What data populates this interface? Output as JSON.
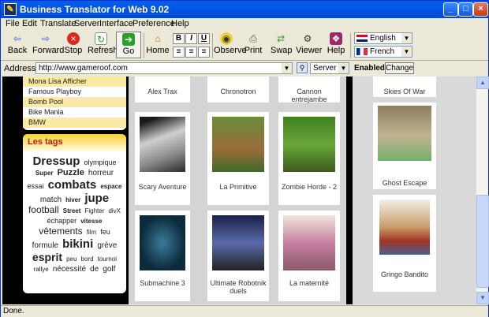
{
  "window": {
    "title": "Business Translator for Web 9.02",
    "minimize": "_",
    "maximize": "□",
    "close": "×"
  },
  "menu": [
    "File",
    "Edit",
    "Translate",
    "Server",
    "Interface",
    "Preference",
    "Help"
  ],
  "toolbar": {
    "back": "Back",
    "forward": "Forward",
    "stop": "Stop",
    "refresh": "Refresh",
    "go": "Go",
    "home": "Home",
    "bold": "B",
    "italic": "I",
    "underline": "U",
    "observe": "Observe",
    "print": "Print",
    "swap": "Swap",
    "viewer": "Viewer",
    "help": "Help"
  },
  "languages": {
    "source": "English",
    "target": "French"
  },
  "address": {
    "label": "Address",
    "url": "http://www.gameroof.com",
    "server": "Server 5",
    "status": "Enabled",
    "change": "Change"
  },
  "links": [
    {
      "label": "Mona Lisa Afficher",
      "highlight": true
    },
    {
      "label": "Famous Playboy",
      "highlight": false
    },
    {
      "label": "Bomb Pool",
      "highlight": true
    },
    {
      "label": "Bike Mania",
      "highlight": false
    },
    {
      "label": "BMW",
      "highlight": true
    }
  ],
  "tags_title": "Les tags",
  "tags": [
    {
      "t": "Dressup",
      "s": 15,
      "b": true
    },
    {
      "t": "olympique",
      "s": 9
    },
    {
      "t": "Super",
      "s": 8,
      "b": true
    },
    {
      "t": "Puzzle",
      "s": 11,
      "b": true
    },
    {
      "t": "horreur",
      "s": 10
    },
    {
      "t": "essai",
      "s": 9
    },
    {
      "t": "combats",
      "s": 15,
      "b": true
    },
    {
      "t": "espace",
      "s": 8,
      "b": true
    },
    {
      "t": "match",
      "s": 10
    },
    {
      "t": "hiver",
      "s": 8,
      "b": true
    },
    {
      "t": "jupe",
      "s": 15,
      "b": true
    },
    {
      "t": "football",
      "s": 12
    },
    {
      "t": "Street",
      "s": 8,
      "b": true
    },
    {
      "t": "Fighter",
      "s": 8
    },
    {
      "t": "divX",
      "s": 8
    },
    {
      "t": "échapper",
      "s": 9
    },
    {
      "t": "vitesse",
      "s": 8,
      "b": true
    },
    {
      "t": "vêtements",
      "s": 12
    },
    {
      "t": "film",
      "s": 8
    },
    {
      "t": "feu",
      "s": 9
    },
    {
      "t": "formule",
      "s": 10
    },
    {
      "t": "bikini",
      "s": 15,
      "b": true
    },
    {
      "t": "grève",
      "s": 10
    },
    {
      "t": "esprit",
      "s": 14,
      "b": true
    },
    {
      "t": "peu",
      "s": 8
    },
    {
      "t": "bord",
      "s": 8
    },
    {
      "t": "tournoi",
      "s": 8
    },
    {
      "t": "rallye",
      "s": 8
    },
    {
      "t": "nécessité",
      "s": 10
    },
    {
      "t": "de",
      "s": 10
    },
    {
      "t": "golf",
      "s": 10
    }
  ],
  "games_mid": [
    {
      "name": "Alex Trax",
      "row": 0,
      "col": 0
    },
    {
      "name": "Chronotron",
      "row": 0,
      "col": 1
    },
    {
      "name": "Cannon entrejambe",
      "row": 0,
      "col": 2
    },
    {
      "name": "Scary Aventure",
      "row": 1,
      "col": 0
    },
    {
      "name": "La Primitive",
      "row": 1,
      "col": 1
    },
    {
      "name": "Zombie Horde - 2",
      "row": 1,
      "col": 2
    },
    {
      "name": "Submachine 3",
      "row": 2,
      "col": 0
    },
    {
      "name": "Ultimate Robotnik duels",
      "row": 2,
      "col": 1
    },
    {
      "name": "La maternité",
      "row": 2,
      "col": 2
    }
  ],
  "games_right": [
    {
      "name": "Skies Of War"
    },
    {
      "name": "Ghost Escape"
    },
    {
      "name": "Gringo Bandito"
    }
  ],
  "status": "Done.",
  "colors": {
    "title_bar": "#0058ee",
    "tags_header": "#c81b0b",
    "link_highlight": "#fbe9a6"
  }
}
